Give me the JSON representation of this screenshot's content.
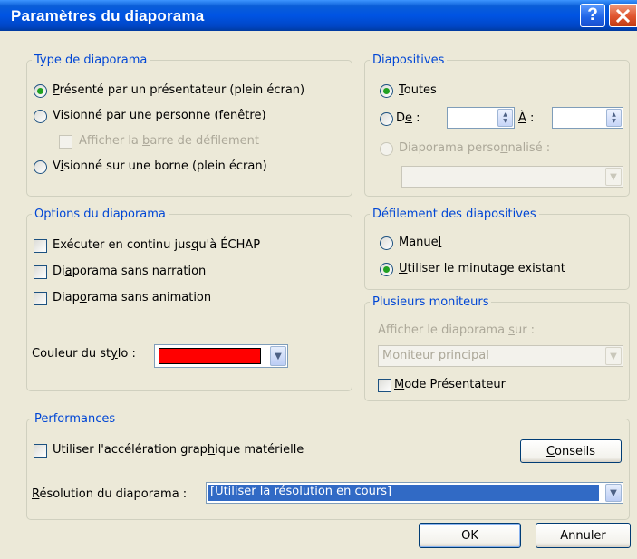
{
  "dialog": {
    "title": "Paramètres du diaporama"
  },
  "icons": {
    "help": "help-icon",
    "close": "close-icon"
  },
  "type_group": {
    "legend": "Type de diaporama",
    "opt1": {
      "pre": "",
      "key": "P",
      "post": "résenté par un présentateur (plein écran)",
      "checked": true
    },
    "opt2": {
      "pre": "",
      "key": "V",
      "post": "isionné par une personne (fenêtre)",
      "checked": false
    },
    "scrollbar": {
      "pre": "Afficher la ",
      "key": "b",
      "post": "arre de défilement"
    },
    "opt3": {
      "pre": "V",
      "key": "i",
      "post": "sionné sur une borne (plein écran)",
      "checked": false
    }
  },
  "slides_group": {
    "legend": "Diapositives",
    "all": {
      "pre": "",
      "key": "T",
      "post": "outes",
      "checked": true
    },
    "from": {
      "pre": "D",
      "key": "e",
      "post": " :",
      "value": ""
    },
    "to": {
      "pre": "",
      "key": "À",
      "post": " :",
      "value": ""
    },
    "custom": {
      "pre": "Diaporama perso",
      "key": "n",
      "post": "nalisé :",
      "value": ""
    }
  },
  "options_group": {
    "legend": "Options du diaporama",
    "loop": {
      "pre": "Exécuter en continu jus",
      "key": "q",
      "post": "u'à ÉCHAP",
      "checked": false
    },
    "no_narration": {
      "pre": "Di",
      "key": "a",
      "post": "porama sans narration",
      "checked": false
    },
    "no_animation": {
      "pre": "Diap",
      "key": "o",
      "post": "rama sans animation",
      "checked": false
    },
    "pen_color": {
      "pre": "Couleur du st",
      "key": "y",
      "post": "lo :",
      "color": "#ff0000"
    }
  },
  "advance_group": {
    "legend": "Défilement des diapositives",
    "manual": {
      "pre": "Manue",
      "key": "l",
      "post": "",
      "checked": false
    },
    "timings": {
      "pre": "",
      "key": "U",
      "post": "tiliser le minutage existant",
      "checked": true
    }
  },
  "monitors_group": {
    "legend": "Plusieurs moniteurs",
    "show_on": {
      "pre": "Afficher le diaporama ",
      "key": "s",
      "post": "ur :"
    },
    "monitor_value": "Moniteur principal",
    "presenter": {
      "pre": "",
      "key": "M",
      "post": "ode Présentateur",
      "checked": false
    }
  },
  "performance_group": {
    "legend": "Performances",
    "hw_accel": {
      "pre": "Utiliser l'accélération grap",
      "key": "h",
      "post": "ique matérielle",
      "checked": false
    },
    "tips_button": {
      "pre": "",
      "key": "C",
      "post": "onseils"
    },
    "resolution": {
      "pre": "",
      "key": "R",
      "post": "ésolution du diaporama :",
      "value": "[Utiliser la résolution en cours]"
    }
  },
  "footer": {
    "ok": "OK",
    "cancel": "Annuler"
  }
}
